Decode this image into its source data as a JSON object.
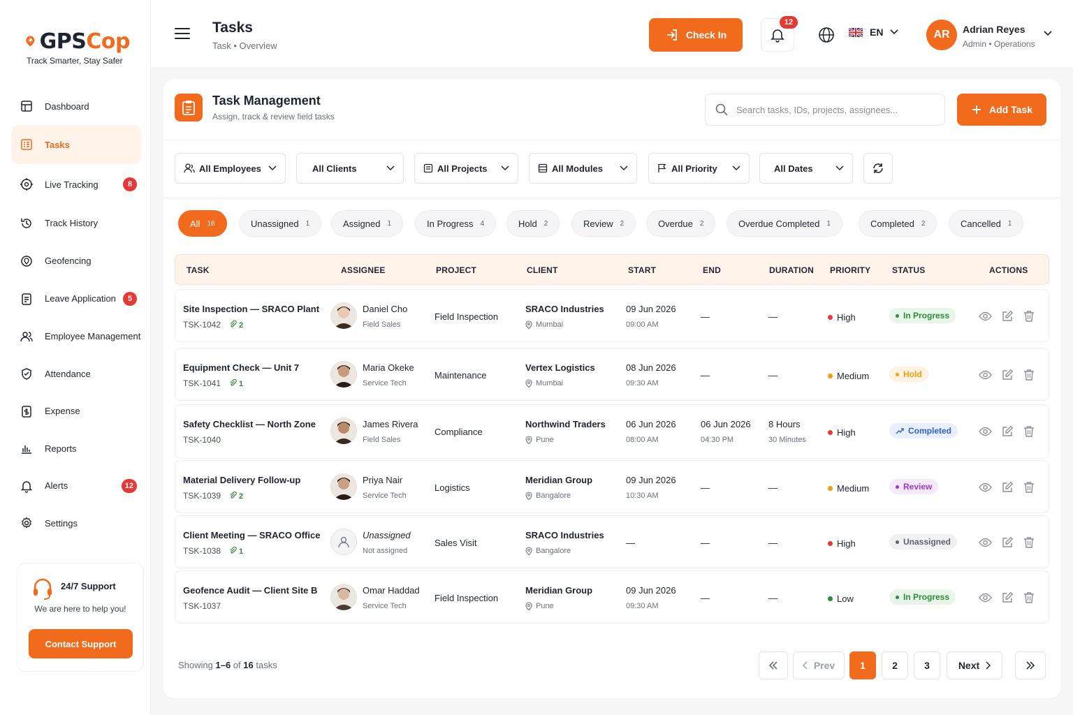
{
  "brand": {
    "name_a": "GPS",
    "name_b": "Cop",
    "tagline": "Track Smarter, Stay Safer",
    "accent": "#f26a1b"
  },
  "sidebar": {
    "items": [
      {
        "label": "Dashboard",
        "icon": "dashboard-icon",
        "badge": null
      },
      {
        "label": "Tasks",
        "icon": "tasks-icon",
        "badge": null,
        "active": true
      },
      {
        "label": "Live Tracking",
        "icon": "live-tracking-icon",
        "badge": "8"
      },
      {
        "label": "Track History",
        "icon": "history-icon",
        "badge": null
      },
      {
        "label": "Geofencing",
        "icon": "geofence-icon",
        "badge": null
      },
      {
        "label": "Leave Application",
        "icon": "leave-icon",
        "badge": "5"
      },
      {
        "label": "Employee Management",
        "icon": "employees-icon",
        "badge": null
      },
      {
        "label": "Attendance",
        "icon": "attendance-icon",
        "badge": null
      },
      {
        "label": "Expense",
        "icon": "expense-icon",
        "badge": null
      },
      {
        "label": "Reports",
        "icon": "reports-icon",
        "badge": null
      },
      {
        "label": "Alerts",
        "icon": "bell-icon",
        "badge": "12"
      },
      {
        "label": "Settings",
        "icon": "gear-icon",
        "badge": null
      }
    ],
    "support": {
      "title": "24/7 Support",
      "subtitle": "We are here to help you!",
      "button": "Contact Support"
    }
  },
  "header": {
    "title": "Tasks",
    "breadcrumb": "Task • Overview",
    "check_in": "Check In",
    "notifications": "12",
    "language": "EN",
    "user": {
      "initials": "AR",
      "name": "Adrian Reyes",
      "role": "Admin • Operations"
    }
  },
  "panel": {
    "title": "Task Management",
    "subtitle": "Assign, track & review field tasks",
    "search_placeholder": "Search tasks, IDs, projects, assignees...",
    "add_button": "Add Task"
  },
  "filters": [
    "All Employees",
    "All Clients",
    "All Projects",
    "All Modules",
    "All Priority",
    "All Dates"
  ],
  "status_tabs": [
    {
      "label": "All",
      "count": "16"
    },
    {
      "label": "Unassigned",
      "count": "1"
    },
    {
      "label": "Assigned",
      "count": "1"
    },
    {
      "label": "In Progress",
      "count": "4"
    },
    {
      "label": "Hold",
      "count": "2"
    },
    {
      "label": "Review",
      "count": "2"
    },
    {
      "label": "Overdue",
      "count": "2"
    },
    {
      "label": "Overdue Completed",
      "count": "1"
    },
    {
      "label": "Completed",
      "count": "2"
    },
    {
      "label": "Cancelled",
      "count": "1"
    }
  ],
  "columns": [
    "TASK",
    "ASSIGNEE",
    "PROJECT",
    "CLIENT",
    "START",
    "END",
    "DURATION",
    "PRIORITY",
    "STATUS",
    "ACTIONS"
  ],
  "rows": [
    {
      "task": "Site Inspection — SRACO Plant",
      "id": "TSK-1042",
      "attachments": "2",
      "assignee": "Daniel Cho",
      "role": "Field Sales",
      "project": "Field Inspection",
      "client": "SRACO Industries",
      "city": "Mumbai",
      "start_date": "09 Jun 2026",
      "start_time": "09:00 AM",
      "end_date": "—",
      "end_time": "",
      "duration": "—",
      "duration2": "",
      "priority": "High",
      "status": "In Progress"
    },
    {
      "task": "Equipment Check — Unit 7",
      "id": "TSK-1041",
      "attachments": "1",
      "assignee": "Maria Okeke",
      "role": "Service Tech",
      "project": "Maintenance",
      "client": "Vertex Logistics",
      "city": "Mumbai",
      "start_date": "08 Jun 2026",
      "start_time": "09:30 AM",
      "end_date": "—",
      "end_time": "",
      "duration": "—",
      "duration2": "",
      "priority": "Medium",
      "status": "Hold"
    },
    {
      "task": "Safety Checklist — North Zone",
      "id": "TSK-1040",
      "attachments": "",
      "assignee": "James Rivera",
      "role": "Field Sales",
      "project": "Compliance",
      "client": "Northwind Traders",
      "city": "Pune",
      "start_date": "06 Jun 2026",
      "start_time": "08:00 AM",
      "end_date": "06 Jun 2026",
      "end_time": "04:30 PM",
      "duration": "8 Hours",
      "duration2": "30 Minutes",
      "priority": "High",
      "status": "Completed"
    },
    {
      "task": "Material Delivery Follow-up",
      "id": "TSK-1039",
      "attachments": "2",
      "assignee": "Priya Nair",
      "role": "Service Tech",
      "project": "Logistics",
      "client": "Meridian Group",
      "city": "Bangalore",
      "start_date": "09 Jun 2026",
      "start_time": "10:30 AM",
      "end_date": "—",
      "end_time": "",
      "duration": "—",
      "duration2": "",
      "priority": "Medium",
      "status": "Review"
    },
    {
      "task": "Client Meeting — SRACO Office",
      "id": "TSK-1038",
      "attachments": "1",
      "assignee": "Unassigned",
      "role": "Not assigned",
      "project": "Sales Visit",
      "client": "SRACO Industries",
      "city": "Bangalore",
      "start_date": "—",
      "start_time": "",
      "end_date": "—",
      "end_time": "",
      "duration": "—",
      "duration2": "",
      "priority": "High",
      "status": "Unassigned"
    },
    {
      "task": "Geofence Audit — Client Site B",
      "id": "TSK-1037",
      "attachments": "",
      "assignee": "Omar Haddad",
      "role": "Service Tech",
      "project": "Field Inspection",
      "client": "Meridian Group",
      "city": "Pune",
      "start_date": "09 Jun 2026",
      "start_time": "09:30 AM",
      "end_date": "—",
      "end_time": "",
      "duration": "—",
      "duration2": "",
      "priority": "Low",
      "status": "In Progress"
    }
  ],
  "pagination": {
    "prefix": "Showing ",
    "range": "1–6",
    "of": " of ",
    "total": "16",
    "suffix": " tasks",
    "prev": "Prev",
    "next": "Next",
    "pages": [
      "1",
      "2",
      "3"
    ]
  }
}
